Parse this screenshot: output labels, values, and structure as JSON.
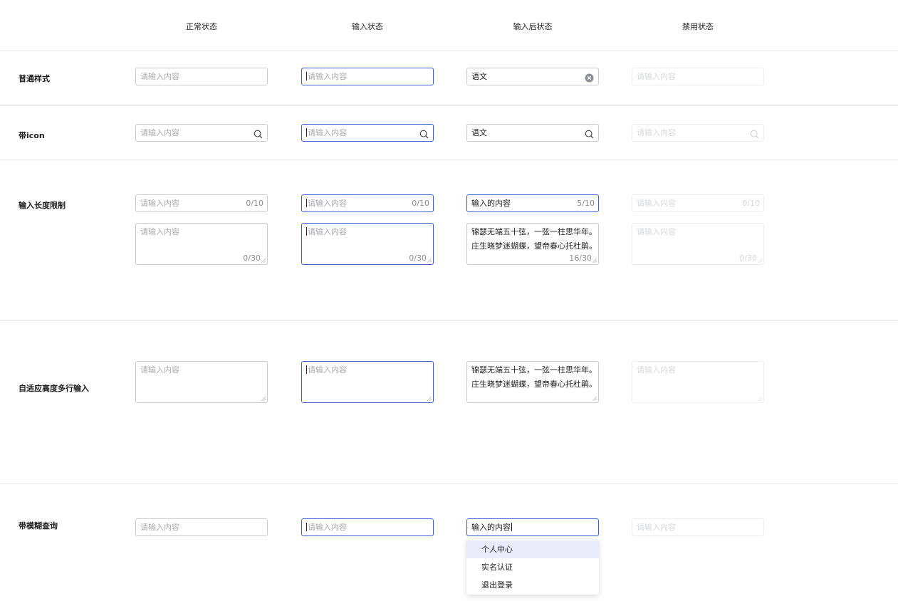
{
  "columns": [
    "正常状态",
    "输入状态",
    "输入后状态",
    "禁用状态"
  ],
  "rows": {
    "basic": "普通样式",
    "icon": "带icon",
    "limit": "输入长度限制",
    "autosize": "自适应高度多行输入",
    "fuzzy": "带模糊查询"
  },
  "placeholder": "请输入内容",
  "values": {
    "typed_short": "语文",
    "typed_limit": "输入的内容",
    "textarea_line1": "锦瑟无端五十弦，一弦一柱思华年。",
    "textarea_line2": "庄生晓梦迷蝴蝶，望帝春心托杜鹃。",
    "fuzzy_typed": "输入的内容"
  },
  "counts": {
    "input_empty": "0/10",
    "input_filled": "5/10",
    "textarea_empty": "0/30",
    "textarea_filled": "16/30"
  },
  "dropdown": [
    "个人中心",
    "实名认证",
    "退出登录"
  ],
  "icons": {
    "clear": "clear-circle-icon",
    "search": "search-icon"
  },
  "colors": {
    "active_border": "#3f5fcf",
    "border": "#c9cbd1",
    "disabled_border": "#ededf0",
    "hover_bg": "#e8ecfa"
  }
}
